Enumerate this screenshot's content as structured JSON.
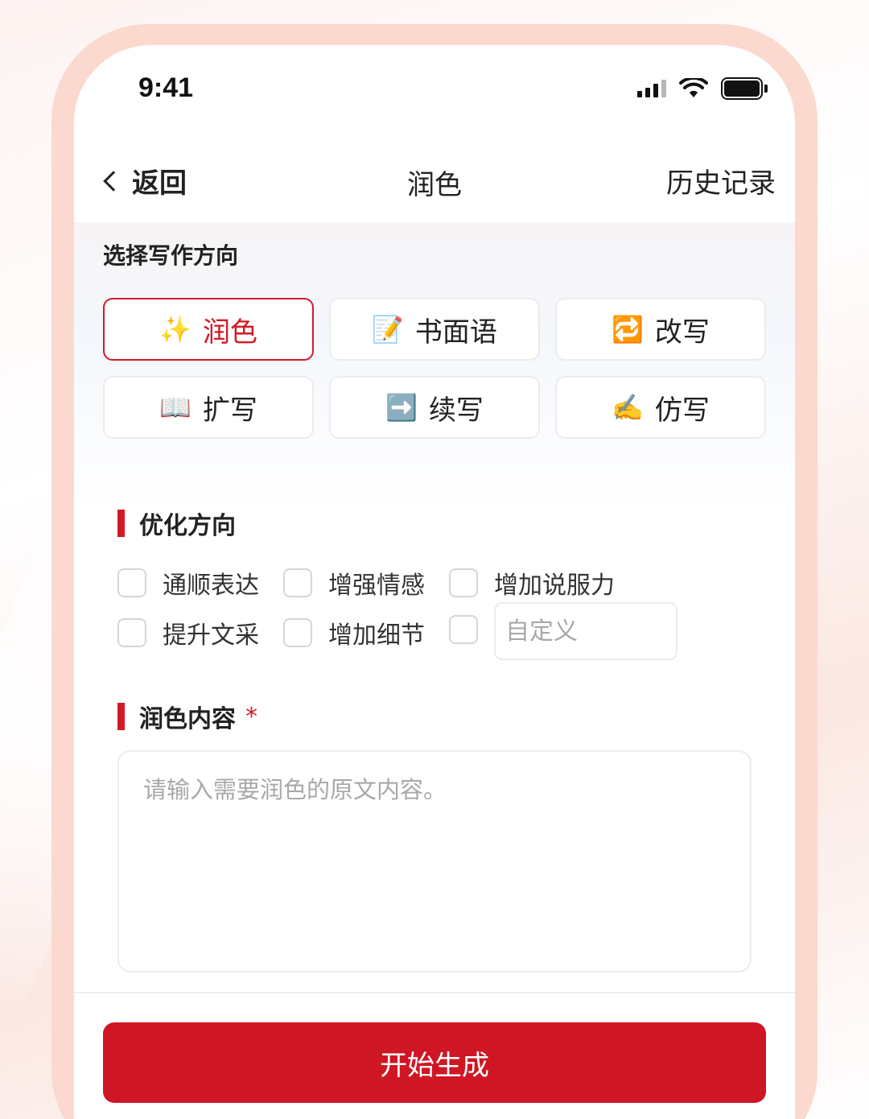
{
  "status_bar": {
    "time": "9:41"
  },
  "nav": {
    "back_label": "返回",
    "title": "润色",
    "history_label": "历史记录"
  },
  "writing_direction": {
    "title": "选择写作方向",
    "modes": [
      {
        "icon": "✨",
        "label": "润色",
        "active": true
      },
      {
        "icon": "📝",
        "label": "书面语",
        "active": false
      },
      {
        "icon": "🔁",
        "label": "改写",
        "active": false
      },
      {
        "icon": "📖",
        "label": "扩写",
        "active": false
      },
      {
        "icon": "➡️",
        "label": "续写",
        "active": false
      },
      {
        "icon": "✍️",
        "label": "仿写",
        "active": false
      }
    ]
  },
  "optimize": {
    "title": "优化方向",
    "options": [
      "通顺表达",
      "增强情感",
      "增加说服力",
      "提升文采",
      "增加细节"
    ],
    "custom_placeholder": "自定义"
  },
  "content": {
    "title": "润色内容",
    "required_mark": "*",
    "placeholder": "请输入需要润色的原文内容。"
  },
  "actions": {
    "generate_label": "开始生成"
  },
  "colors": {
    "accent": "#cf1624"
  }
}
